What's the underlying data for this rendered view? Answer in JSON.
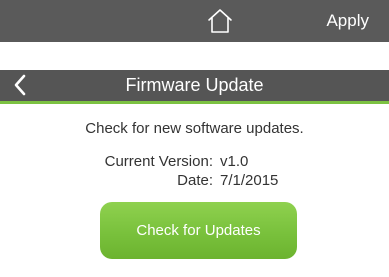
{
  "topbar": {
    "home_icon": "home-icon",
    "apply_label": "Apply"
  },
  "firmware": {
    "back_icon": "chevron-left-icon",
    "title": "Firmware Update",
    "check_text": "Check for new software updates.",
    "version_label": "Current Version:",
    "version_value": "v1.0",
    "date_label": "Date:",
    "date_value": "7/1/2015",
    "check_button_label": "Check for Updates"
  },
  "colors": {
    "bar_bg": "#5a5a5a",
    "accent_green": "#7cc242"
  }
}
